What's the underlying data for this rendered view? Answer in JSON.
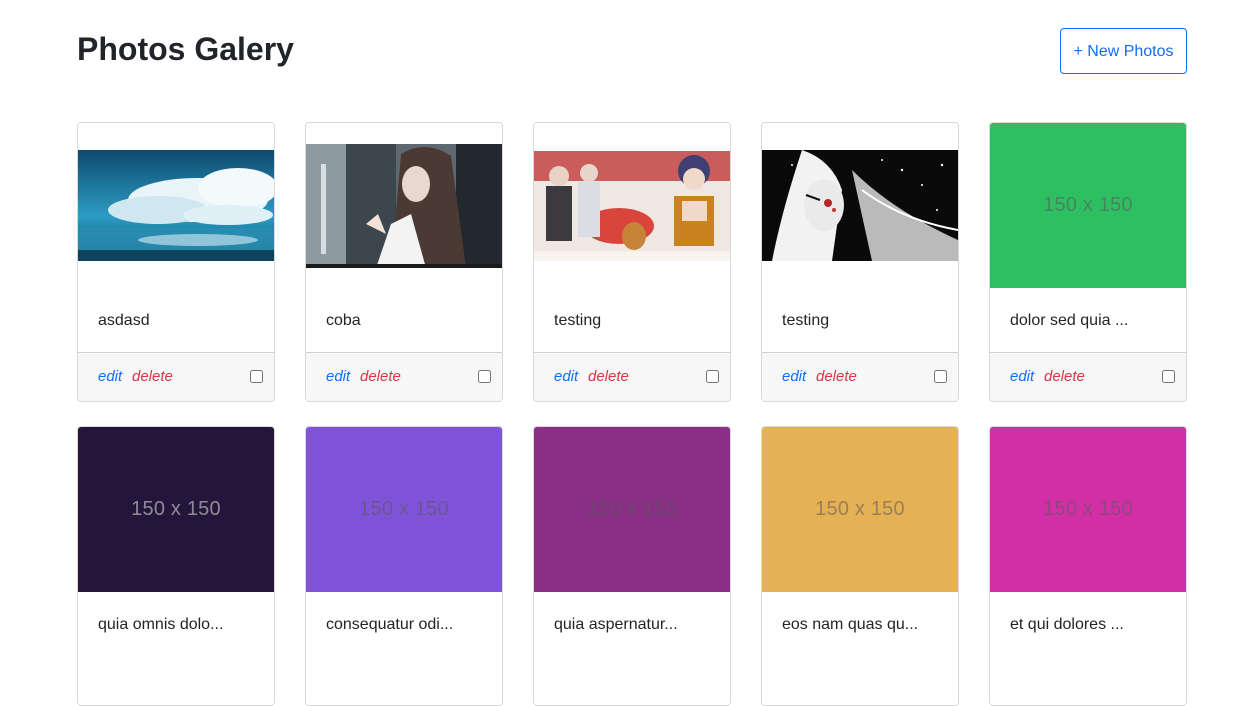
{
  "header": {
    "title": "Photos Galery",
    "new_button_label": "+ New Photos"
  },
  "card_actions": {
    "edit_label": "edit",
    "delete_label": "delete"
  },
  "photos": [
    {
      "title": "asdasd",
      "kind": "photo",
      "art": "sky-clouds"
    },
    {
      "title": "coba",
      "kind": "photo",
      "art": "anime-window"
    },
    {
      "title": "testing",
      "kind": "photo",
      "art": "anime-group"
    },
    {
      "title": "testing",
      "kind": "photo",
      "art": "monochrome-portrait"
    },
    {
      "title": "dolor sed quia ...",
      "kind": "placeholder",
      "label": "150 x 150",
      "color": "#2ebf62"
    },
    {
      "title": "quia omnis dolo...",
      "kind": "placeholder",
      "label": "150 x 150",
      "color": "#24163a"
    },
    {
      "title": "consequatur odi...",
      "kind": "placeholder",
      "label": "150 x 150",
      "color": "#8153d9"
    },
    {
      "title": "quia aspernatur...",
      "kind": "placeholder",
      "label": "150 x 150",
      "color": "#8a2f86"
    },
    {
      "title": "eos nam quas qu...",
      "kind": "placeholder",
      "label": "150 x 150",
      "color": "#e6b055"
    },
    {
      "title": "et qui dolores ...",
      "kind": "placeholder",
      "label": "150 x 150",
      "color": "#d22fa7"
    }
  ]
}
